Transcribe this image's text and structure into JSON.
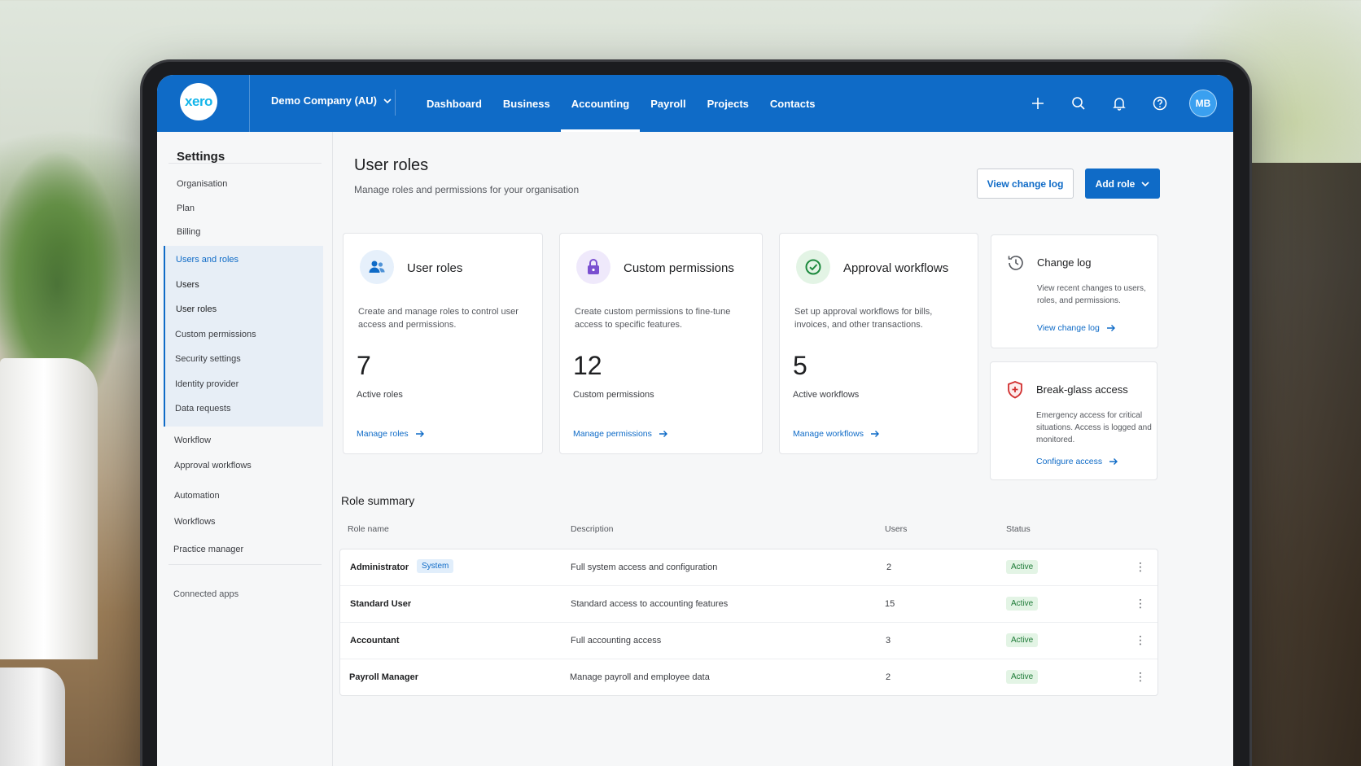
{
  "brand": {
    "logo_text": "xero",
    "accent": "#0f6bc7"
  },
  "nav": {
    "organization": "Demo Company (AU)",
    "items": [
      {
        "label": "Dashboard",
        "active": false
      },
      {
        "label": "Business",
        "active": false
      },
      {
        "label": "Accounting",
        "active": true
      },
      {
        "label": "Payroll",
        "active": false
      },
      {
        "label": "Projects",
        "active": false
      },
      {
        "label": "Contacts",
        "active": false
      }
    ],
    "icons": [
      "plus-icon",
      "search-icon",
      "bell-icon",
      "help-icon"
    ],
    "avatar_initials": "MB"
  },
  "sidebar": {
    "title": "Settings",
    "items": [
      "Organisation",
      "Plan",
      "Billing",
      "Users and roles",
      "Users",
      "User roles",
      "Custom permissions",
      "Security settings",
      "Identity provider",
      "Data requests",
      "Workflow",
      "Approval workflows",
      "Automation",
      "Workflows",
      "Practice manager",
      "Connected apps"
    ],
    "selected": "Users and roles",
    "current": "User roles"
  },
  "header": {
    "title": "User roles",
    "subtitle": "Manage roles and permissions for your organisation",
    "view_change_log": "View change log",
    "add_role": "Add role"
  },
  "cards": [
    {
      "title": "User roles",
      "desc": "Create and manage roles to control user access and permissions.",
      "number": "7",
      "label": "Active roles",
      "link": "Manage roles",
      "icon": "users-icon"
    },
    {
      "title": "Custom permissions",
      "desc": "Create custom permissions to fine-tune access to specific features.",
      "number": "12",
      "label": "Custom permissions",
      "link": "Manage permissions",
      "icon": "lock-icon"
    },
    {
      "title": "Approval workflows",
      "desc": "Set up approval workflows for bills, invoices, and other transactions.",
      "number": "5",
      "label": "Active workflows",
      "link": "Manage workflows",
      "icon": "check-circle-icon"
    }
  ],
  "side_cards": [
    {
      "title": "Change log",
      "desc": "View recent changes to users, roles, and permissions.",
      "link": "View change log",
      "icon": "clock-icon"
    },
    {
      "title": "Break-glass access",
      "desc": "Emergency access for critical situations. Access is logged and monitored.",
      "link": "Configure access",
      "icon": "shield-plus-icon"
    }
  ],
  "role_summary": {
    "title": "Role summary",
    "columns": [
      "Role name",
      "Description",
      "Users",
      "Status"
    ],
    "rows": [
      {
        "name": "Administrator",
        "tag": "System",
        "desc": "Full system access and configuration",
        "users": "2",
        "status": "Active"
      },
      {
        "name": "Standard User",
        "tag": "",
        "desc": "Standard access to accounting features",
        "users": "15",
        "status": "Active"
      },
      {
        "name": "Accountant",
        "tag": "",
        "desc": "Full accounting access",
        "users": "3",
        "status": "Active"
      },
      {
        "name": "Payroll Manager",
        "tag": "",
        "desc": "Manage payroll and employee data",
        "users": "2",
        "status": "Active"
      }
    ]
  }
}
